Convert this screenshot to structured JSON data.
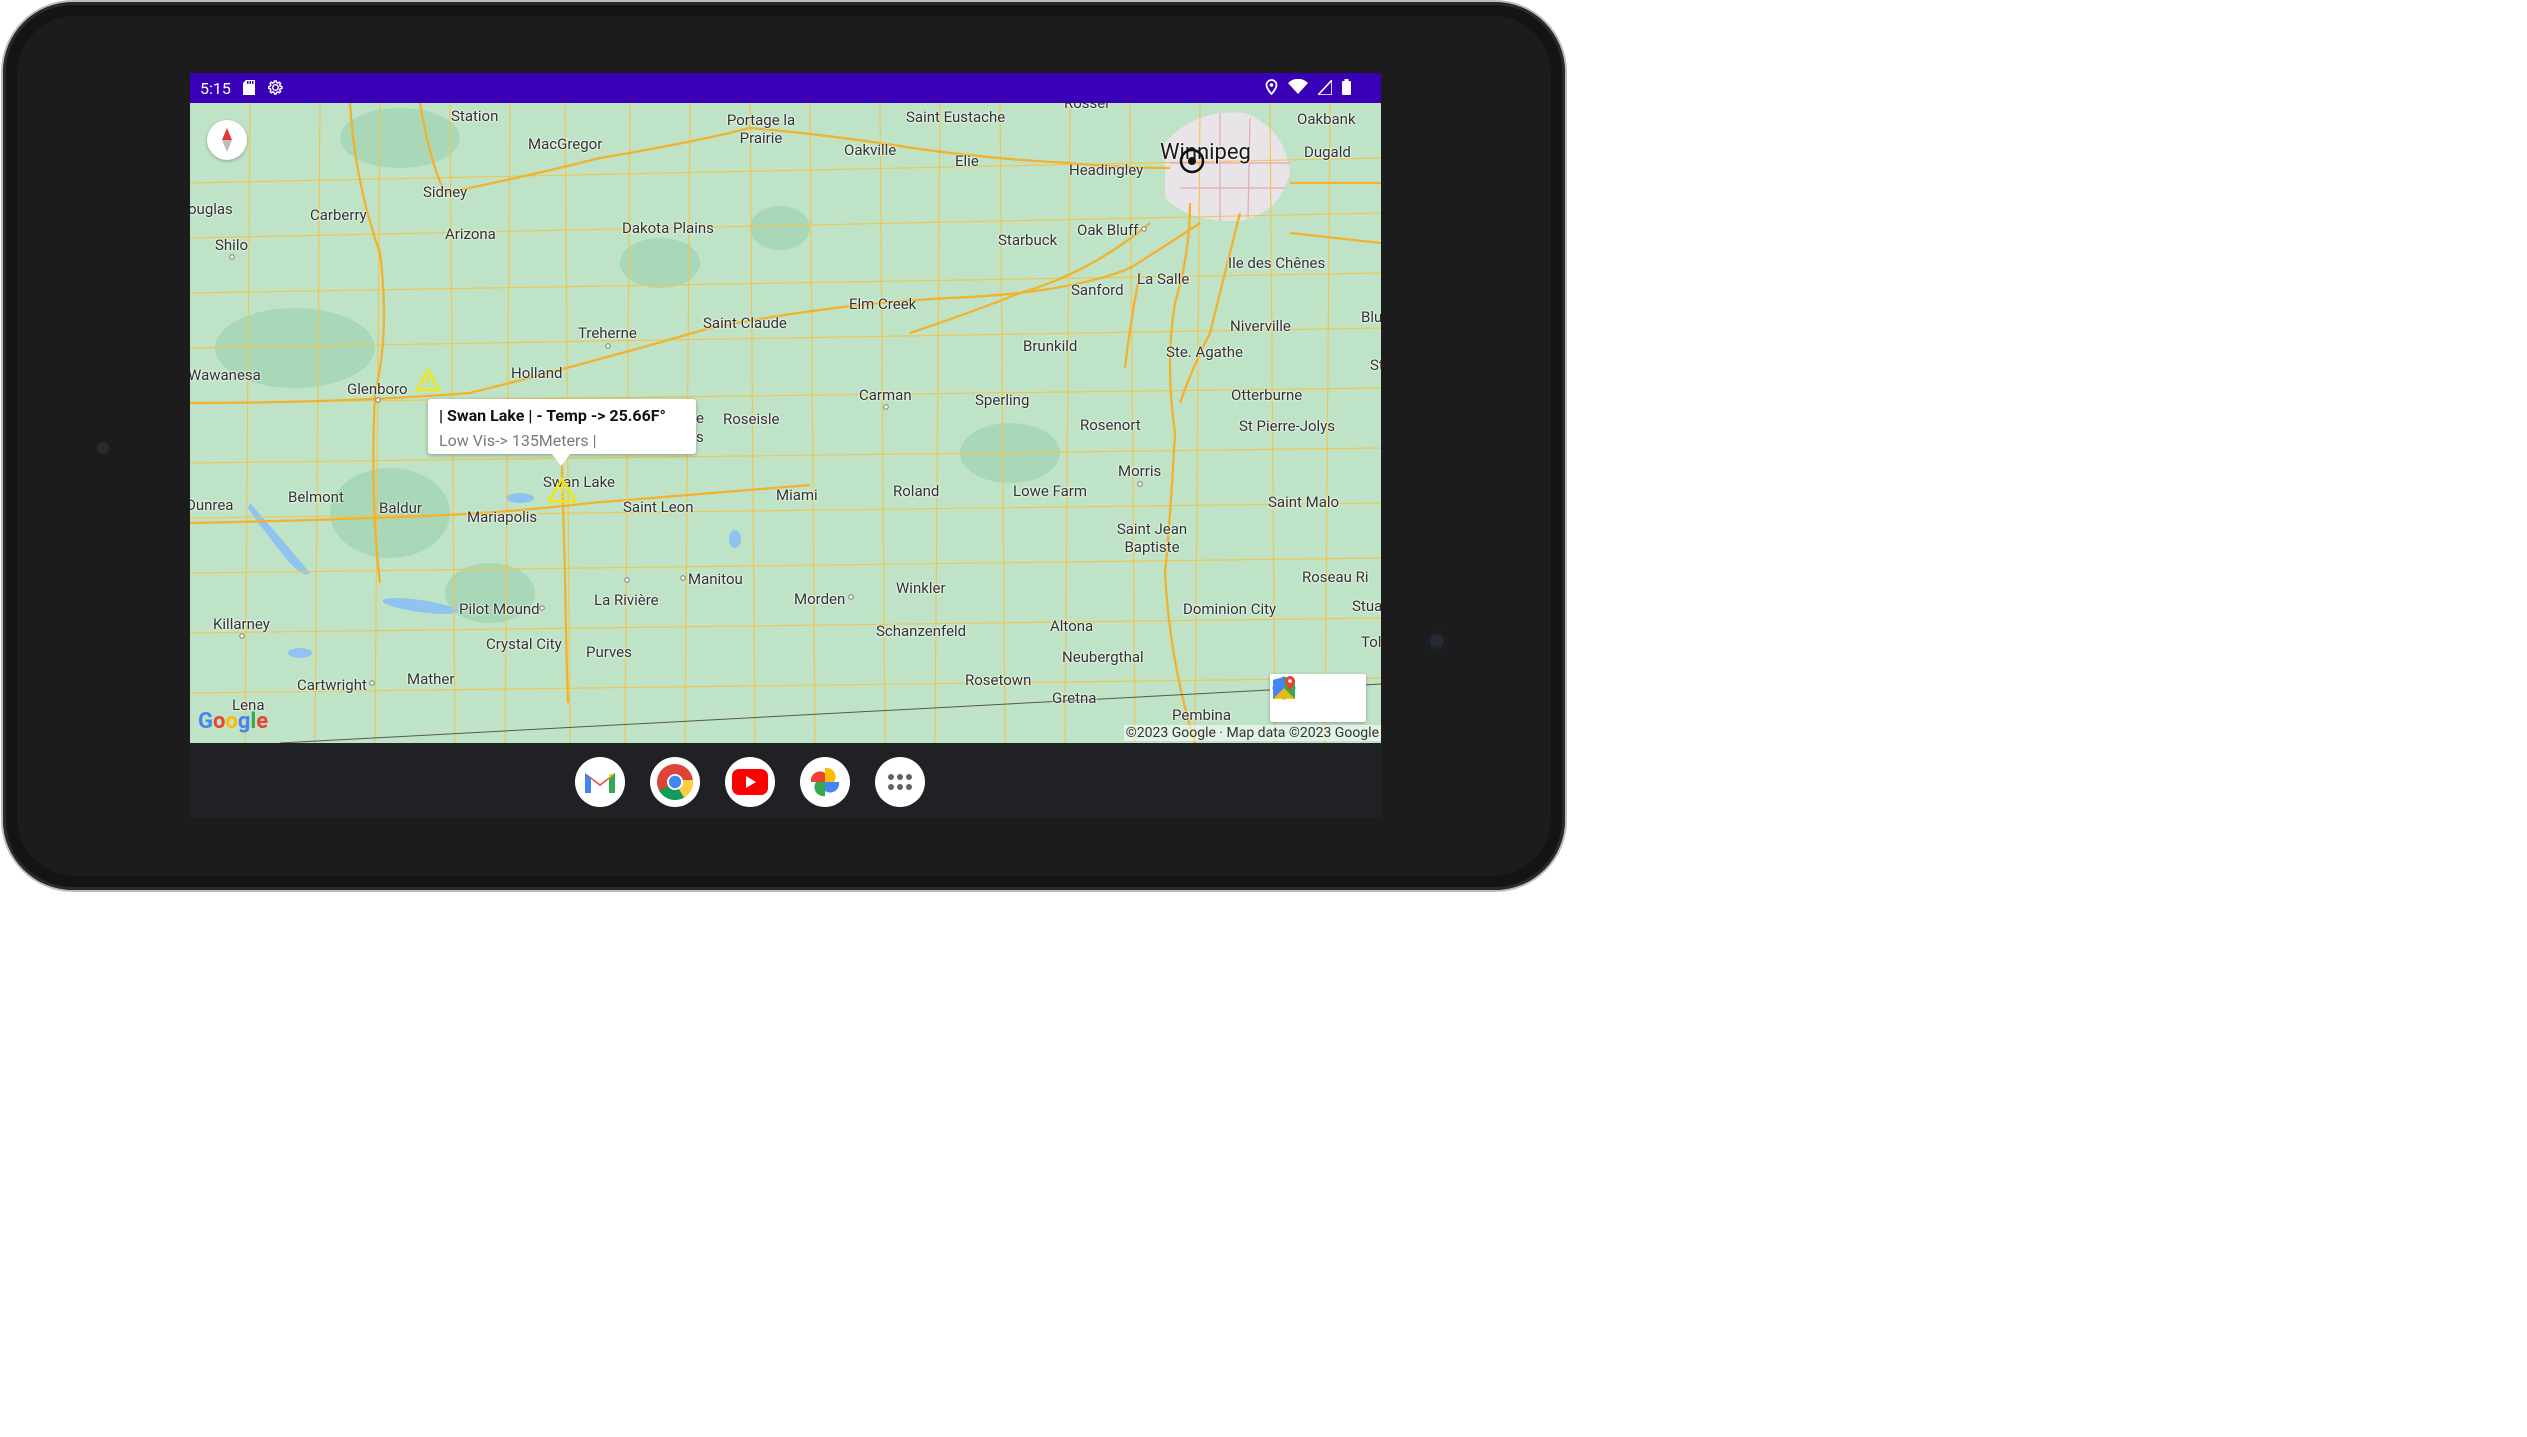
{
  "status_bar": {
    "time": "5:15",
    "left_icons": [
      "sd-card-icon",
      "settings-gear-icon"
    ],
    "right_icons": [
      "location-icon",
      "wifi-icon",
      "cell-signal-icon",
      "battery-icon"
    ],
    "background_color": "#3a00b7"
  },
  "map": {
    "place_labels": [
      "Station",
      "MacGregor",
      "Portage la Prairie",
      "Saint Eustache",
      "Oakville",
      "Elie",
      "Headingley",
      "Winnipeg",
      "Oakbank",
      "Dugald",
      "Sidney",
      "ouglas",
      "Carberry",
      "Arizona",
      "Dakota Plains",
      "Shilo",
      "Starbuck",
      "Oak Bluff",
      "Ile des Chênes",
      "La Salle",
      "Sanford",
      "Elm Creek",
      "Niverville",
      "Blu",
      "Treherne",
      "Saint Claude",
      "Brunkild",
      "Ste. Agathe",
      "St",
      "Wawanesa",
      "Glenboro",
      "Holland",
      "Otterburne",
      "Carman",
      "Sperling",
      "Roseisle",
      "Rosenort",
      "St Pierre-Jolys",
      "Swan Lake",
      "Morris",
      "Dunrea",
      "Belmont",
      "Baldur",
      "Mariapolis",
      "Saint Leon",
      "Miami",
      "Roland",
      "Lowe Farm",
      "Saint Malo",
      "Saint Jean Baptiste",
      "Manitou",
      "Winkler",
      "Roseau Ri",
      "Dominion City",
      "Stuar",
      "Pilot Mound",
      "La Rivière",
      "Morden",
      "Schanzenfeld",
      "Altona",
      "Tolst",
      "Killarney",
      "Crystal City",
      "Purves",
      "Neubergthal",
      "Mather",
      "Rosetown",
      "Cartwright",
      "Lena",
      "Gretna",
      "Pembina",
      "e",
      "s",
      "Rosser"
    ],
    "info_window": {
      "title": "| Swan Lake | - Temp -> 25.66F°",
      "snippet": "Low Vis-> 135Meters |"
    },
    "markers": [
      "warning-marker-glenboro",
      "warning-marker-swan-lake"
    ],
    "marker_color": "#f5e800",
    "google_logo": "Google",
    "copyright": "©2023 Google · Map data ©2023 Google",
    "land_color": "#bfe3c6",
    "road_color": "#f4c34d"
  },
  "dock": {
    "apps": [
      "gmail-icon",
      "chrome-icon",
      "youtube-icon",
      "photos-icon",
      "app-drawer-icon"
    ]
  }
}
